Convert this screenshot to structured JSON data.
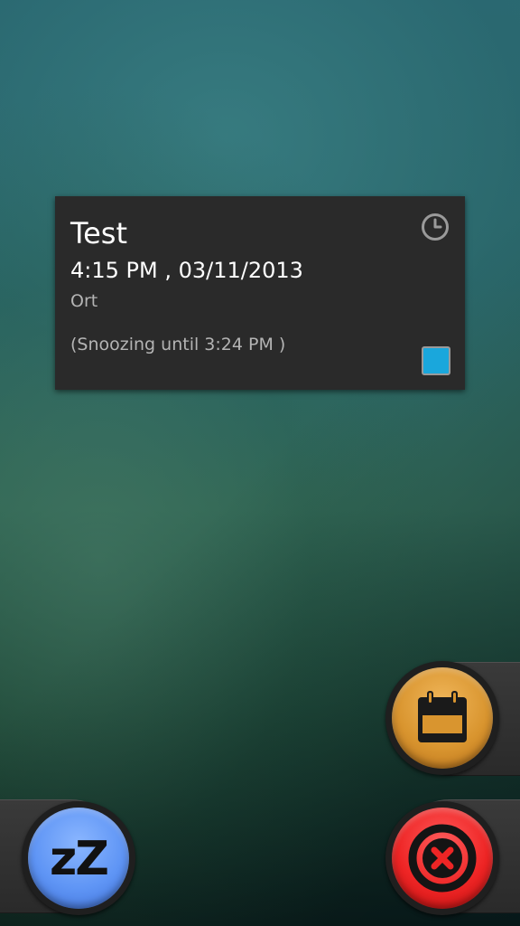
{
  "notification": {
    "title": "Test",
    "datetime": "4:15 PM , 03/11/2013",
    "location": "Ort",
    "snooze_status": "(Snoozing until 3:24 PM )",
    "clock_icon": "clock-icon",
    "color_chip": "#1aa7dc"
  },
  "actions": {
    "snooze": {
      "label": "zZ",
      "icon": "snooze-icon",
      "color": "#5f95f5"
    },
    "calendar": {
      "icon": "calendar-icon",
      "color": "#d9952f"
    },
    "dismiss": {
      "icon": "close-circle-icon",
      "color": "#ee2525"
    }
  }
}
